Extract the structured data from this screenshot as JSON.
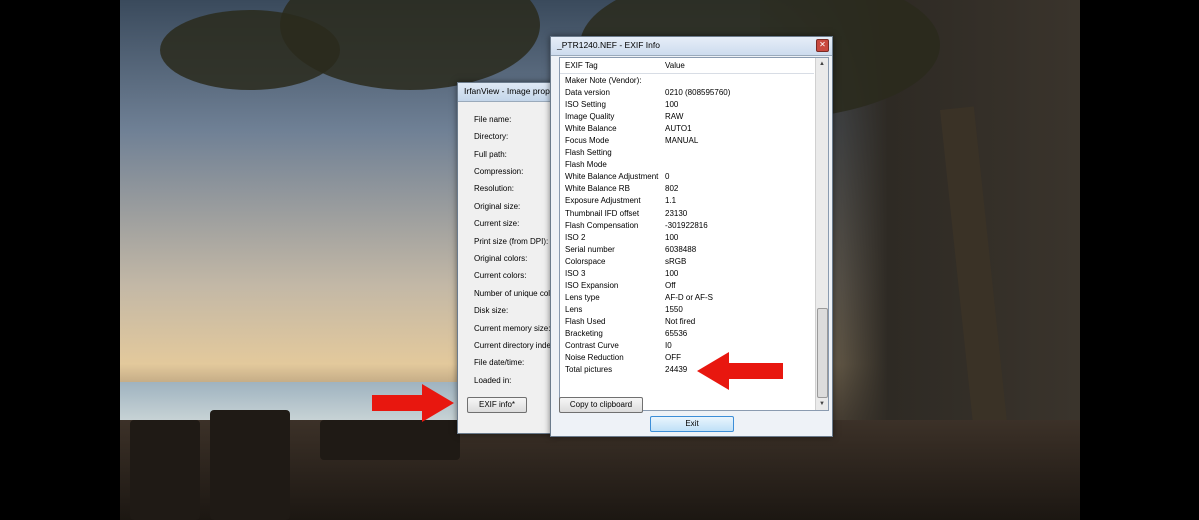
{
  "irfan_window": {
    "title": "IrfanView - Image prop",
    "labels": [
      "File name:",
      "Directory:",
      "Full path:",
      "Compression:",
      "Resolution:",
      "Original size:",
      "Current size:",
      "Print size (from DPI):",
      "Original colors:",
      "Current colors:",
      "Number of unique colo",
      "Disk size:",
      "Current memory size:",
      "Current directory index:",
      "File date/time:",
      "Loaded in:"
    ],
    "exif_button": "EXIF info*"
  },
  "exif_window": {
    "title": "_PTR1240.NEF - EXIF Info",
    "close_glyph": "✕",
    "columns": {
      "tag": "EXIF Tag",
      "value": "Value"
    },
    "rows": [
      {
        "tag": "Maker Note (Vendor):",
        "value": ""
      },
      {
        "tag": "Data version",
        "value": "0210 (808595760)"
      },
      {
        "tag": "ISO Setting",
        "value": "100"
      },
      {
        "tag": "Image Quality",
        "value": "RAW"
      },
      {
        "tag": "White Balance",
        "value": "AUTO1"
      },
      {
        "tag": "Focus Mode",
        "value": "MANUAL"
      },
      {
        "tag": "Flash Setting",
        "value": ""
      },
      {
        "tag": "Flash Mode",
        "value": ""
      },
      {
        "tag": "White Balance Adjustment",
        "value": "0"
      },
      {
        "tag": "White Balance RB",
        "value": "802"
      },
      {
        "tag": "Exposure Adjustment",
        "value": "1.1"
      },
      {
        "tag": "Thumbnail IFD offset",
        "value": "23130"
      },
      {
        "tag": "Flash Compensation",
        "value": "-301922816"
      },
      {
        "tag": "ISO 2",
        "value": "100"
      },
      {
        "tag": "Serial number",
        "value": "6038488"
      },
      {
        "tag": "Colorspace",
        "value": "sRGB"
      },
      {
        "tag": "ISO 3",
        "value": "100"
      },
      {
        "tag": "ISO Expansion",
        "value": "Off"
      },
      {
        "tag": "Lens type",
        "value": "AF-D or AF-S"
      },
      {
        "tag": "Lens",
        "value": "1550"
      },
      {
        "tag": "Flash Used",
        "value": "Not fired"
      },
      {
        "tag": "Bracketing",
        "value": "65536"
      },
      {
        "tag": "Contrast Curve",
        "value": "I0"
      },
      {
        "tag": "Noise Reduction",
        "value": "OFF"
      },
      {
        "tag": "Total pictures",
        "value": "24439"
      }
    ],
    "copy_button": "Copy to clipboard",
    "exit_button": "Exit"
  },
  "colors": {
    "arrow": "#e8170f",
    "highlight_button": "#3c8ed8"
  }
}
